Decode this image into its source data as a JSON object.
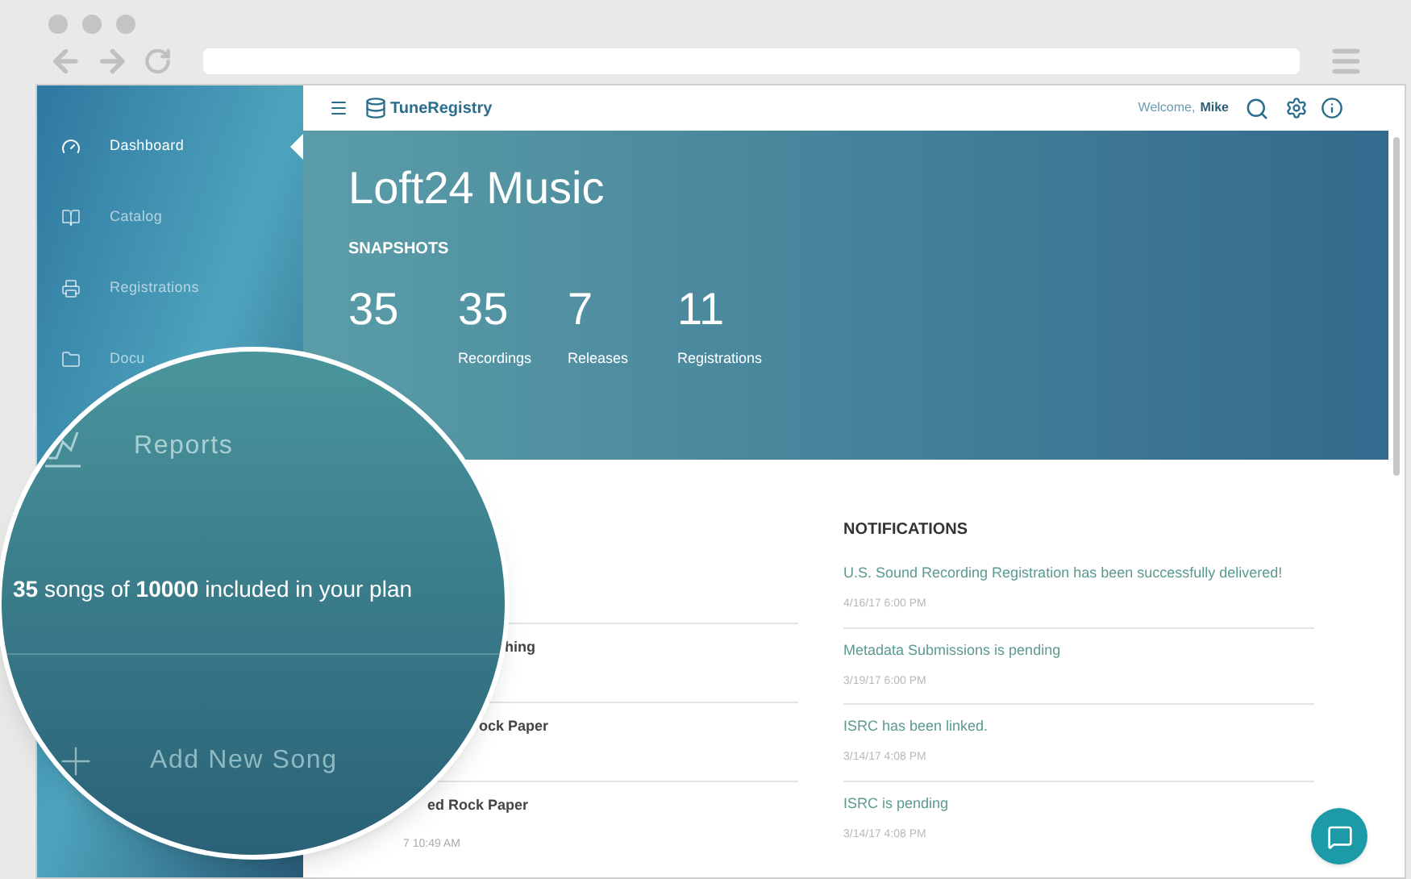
{
  "sidebar": {
    "items": [
      {
        "kind": "dashboard",
        "label": "Dashboard",
        "selected": true
      },
      {
        "kind": "catalog",
        "label": "Catalog",
        "selected": false
      },
      {
        "kind": "registrations",
        "label": "Registrations",
        "selected": false
      },
      {
        "kind": "documents",
        "label": "Docu",
        "selected": false
      }
    ]
  },
  "topbar": {
    "logo": "TuneRegistry",
    "welcome": "Welcome,",
    "user": "Mike"
  },
  "hero": {
    "title": "Loft24 Music",
    "section": "SNAPSHOTS",
    "stats": [
      {
        "value": "35"
      },
      {
        "value": "35",
        "label": "Recordings"
      },
      {
        "value": "7",
        "label": "Releases"
      },
      {
        "value": "11",
        "label": "Registrations"
      }
    ]
  },
  "recent": [
    {
      "title": "hing"
    },
    {
      "title": "ock Paper"
    },
    {
      "title": "ed Rock Paper",
      "time": "7 10:49 AM"
    }
  ],
  "notifications": {
    "heading": "NOTIFICATIONS",
    "items": [
      {
        "text": "U.S. Sound Recording Registration has been successfully delivered!",
        "time": "4/16/17 6:00 PM"
      },
      {
        "text": "Metadata Submissions is pending",
        "time": "3/19/17 6:00 PM"
      },
      {
        "text": "ISRC has been linked.",
        "time": "3/14/17 4:08 PM"
      },
      {
        "text": "ISRC is pending",
        "time": "3/14/17 4:08 PM"
      }
    ]
  },
  "magnifier": {
    "menu_item": "Reports",
    "plan_text": "**35** songs of **10000** included in your plan",
    "action": "Add New Song"
  }
}
